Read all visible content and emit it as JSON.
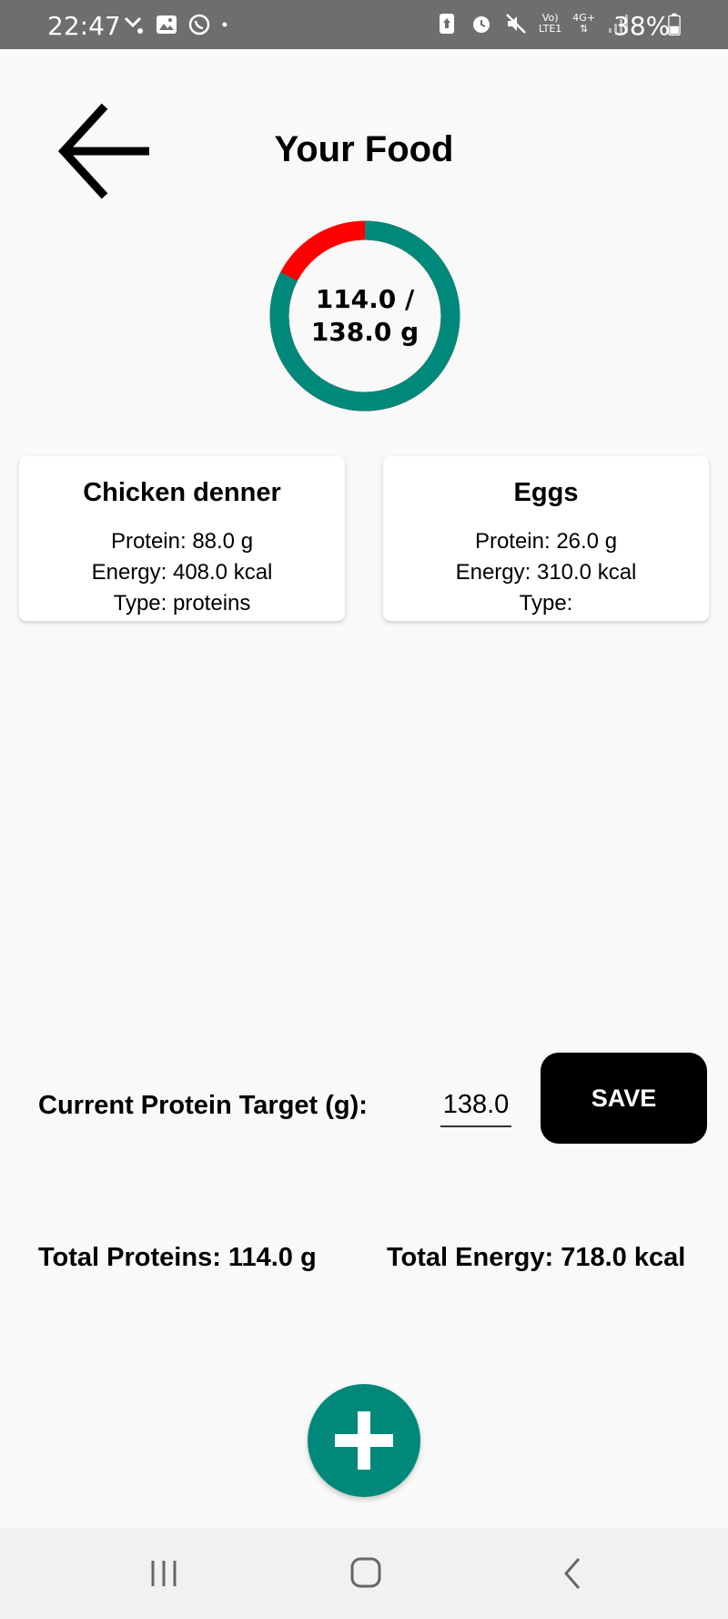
{
  "status_bar": {
    "time": "22:47",
    "battery_percent": "38%",
    "network_top": "Vo)",
    "network_bottom": "LTE1",
    "data_type": "4G+",
    "left_icons": [
      "missed-call-icon",
      "gallery-icon",
      "whatsapp-icon",
      "dot-icon"
    ],
    "right_icons": [
      "upload-icon",
      "alarm-icon",
      "mute-icon",
      "volte-icon",
      "4g-icon",
      "signal-icon",
      "battery-icon"
    ]
  },
  "header": {
    "title": "Your Food",
    "back_icon": "arrow-left-icon"
  },
  "progress": {
    "consumed_text": "114.0 /",
    "target_text": "138.0 g",
    "consumed": 114.0,
    "target": 138.0,
    "fraction": 0.826,
    "color_consumed": "#00897b",
    "color_remaining": "#ff0000"
  },
  "foods": [
    {
      "name": "Chicken denner",
      "protein": "Protein: 88.0 g",
      "energy": "Energy: 408.0 kcal",
      "type": "Type: proteins"
    },
    {
      "name": "Eggs",
      "protein": "Protein: 26.0 g",
      "energy": "Energy: 310.0 kcal",
      "type": "Type:"
    }
  ],
  "target_form": {
    "label": "Current Protein Target (g):",
    "value": "138.0",
    "save_label": "SAVE"
  },
  "totals": {
    "proteins": "Total Proteins: 114.0 g",
    "energy": "Total Energy: 718.0 kcal"
  },
  "fab": {
    "icon": "plus-icon",
    "color": "#00897b"
  },
  "nav_bar": {
    "icons": [
      "recents-icon",
      "home-icon",
      "back-icon"
    ]
  }
}
